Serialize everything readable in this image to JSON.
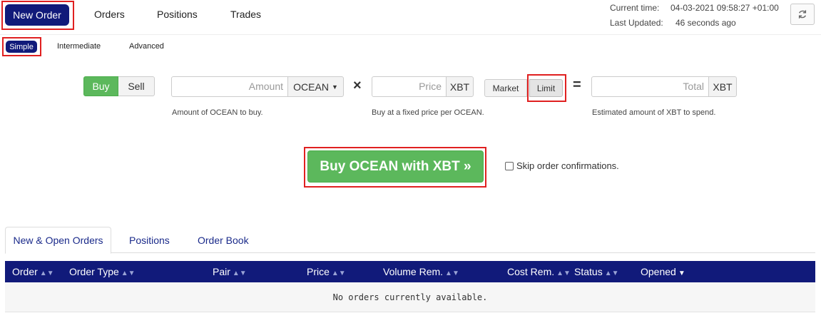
{
  "nav": {
    "new_order": "New Order",
    "orders": "Orders",
    "positions": "Positions",
    "trades": "Trades"
  },
  "status": {
    "current_time_label": "Current time:",
    "current_time_value": "04-03-2021 09:58:27 +01:00",
    "last_updated_label": "Last Updated:",
    "last_updated_value": "46 seconds ago",
    "refresh_icon": "refresh-icon"
  },
  "modes": {
    "simple": "Simple",
    "intermediate": "Intermediate",
    "advanced": "Advanced"
  },
  "order_form": {
    "buy": "Buy",
    "sell": "Sell",
    "amount_placeholder": "Amount",
    "amount_currency": "OCEAN",
    "amount_help": "Amount of OCEAN to buy.",
    "multiply_symbol": "×",
    "price_placeholder": "Price",
    "price_currency": "XBT",
    "price_help": "Buy at a fixed price per OCEAN.",
    "market": "Market",
    "limit": "Limit",
    "equals_symbol": "=",
    "total_placeholder": "Total",
    "total_currency": "XBT",
    "total_help": "Estimated amount of XBT to spend.",
    "submit": "Buy OCEAN with XBT »",
    "skip_confirm": "Skip order confirmations.",
    "skip_checked": false
  },
  "tabs": {
    "open_orders": "New & Open Orders",
    "positions": "Positions",
    "order_book": "Order Book"
  },
  "table": {
    "headers": {
      "order": "Order",
      "order_type": "Order Type",
      "pair": "Pair",
      "price": "Price",
      "volume_rem": "Volume Rem.",
      "cost_rem": "Cost Rem.",
      "status": "Status",
      "opened": "Opened"
    },
    "empty_message": "No orders currently available."
  },
  "colors": {
    "brand_navy": "#111a7a",
    "buy_green": "#5cb85c",
    "highlight_red": "#e02020"
  }
}
